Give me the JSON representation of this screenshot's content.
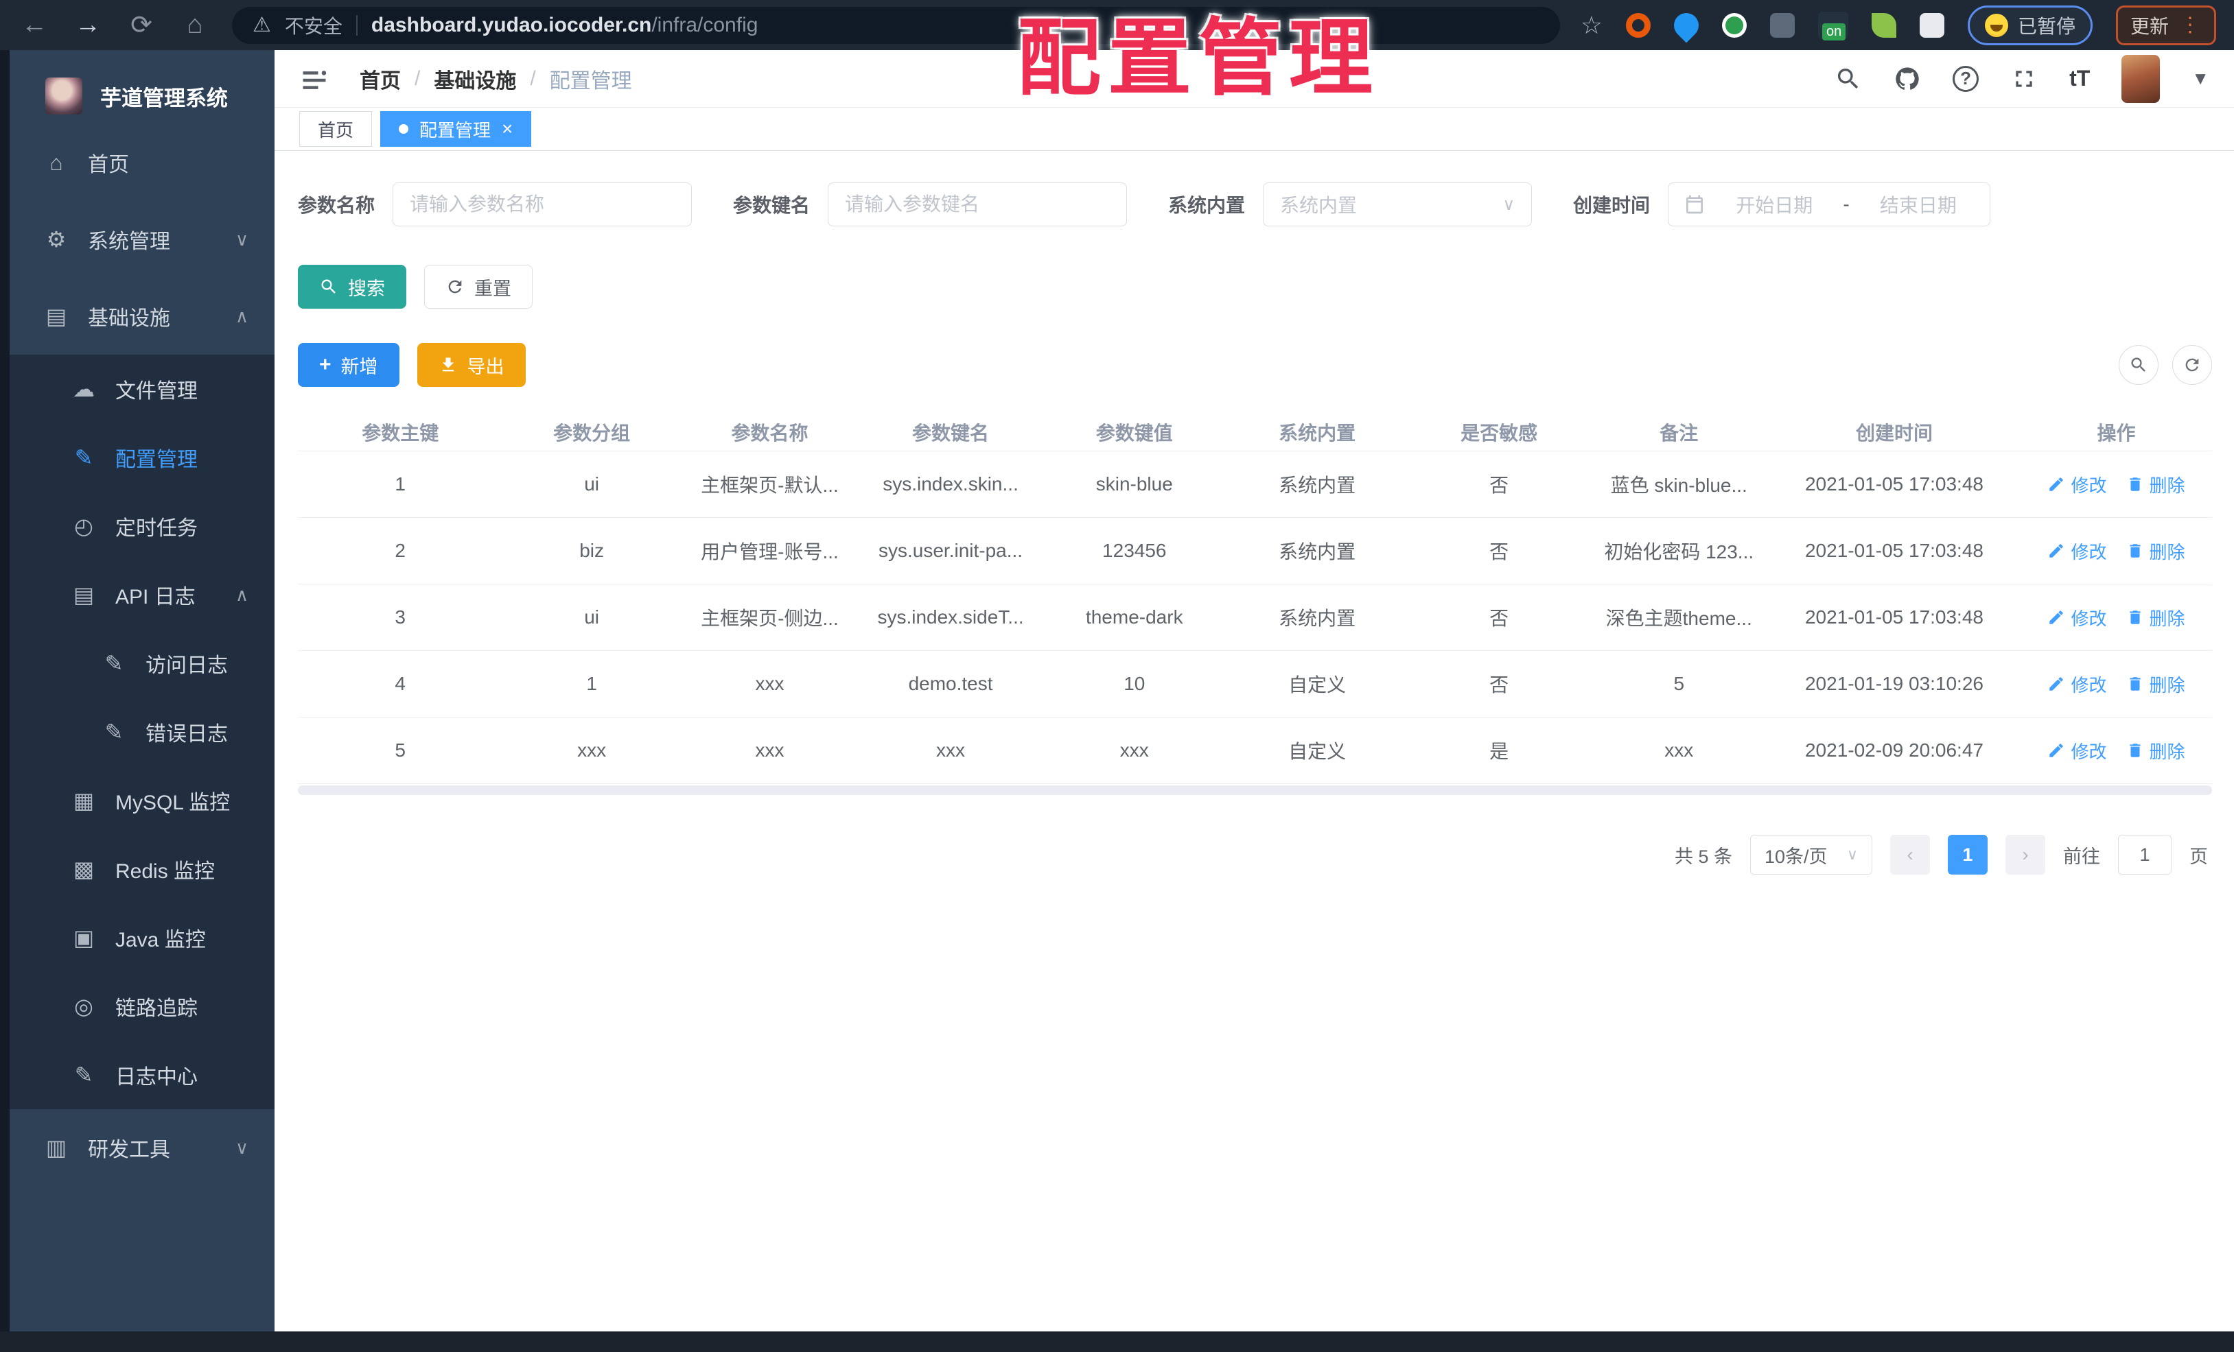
{
  "browser": {
    "insecure_label": "不安全",
    "url_host": "dashboard.yudao.iocoder.cn",
    "url_path": "/infra/config",
    "paused_label": "已暂停",
    "update_label": "更新"
  },
  "overlay": {
    "title": "配置管理",
    "color": "#ee2d52"
  },
  "sidebar": {
    "logo_title": "芋道管理系统",
    "items": [
      {
        "label": "首页",
        "level": 1,
        "icon": "home-icon",
        "glyph": "⌂"
      },
      {
        "label": "系统管理",
        "level": 1,
        "icon": "gear-icon",
        "glyph": "⚙",
        "chevron": "down"
      },
      {
        "label": "基础设施",
        "level": 1,
        "icon": "infra-icon",
        "glyph": "▤",
        "chevron": "up"
      },
      {
        "label": "文件管理",
        "level": 2,
        "icon": "cloud-icon",
        "glyph": "☁"
      },
      {
        "label": "配置管理",
        "level": 2,
        "icon": "edit-icon",
        "glyph": "✎",
        "active": true
      },
      {
        "label": "定时任务",
        "level": 2,
        "icon": "timer-icon",
        "glyph": "◴"
      },
      {
        "label": "API 日志",
        "level": 2,
        "icon": "api-log-icon",
        "glyph": "▤",
        "chevron": "up"
      },
      {
        "label": "访问日志",
        "level": 3,
        "icon": "access-log-icon",
        "glyph": "✎"
      },
      {
        "label": "错误日志",
        "level": 3,
        "icon": "error-log-icon",
        "glyph": "✎"
      },
      {
        "label": "MySQL 监控",
        "level": 2,
        "icon": "mysql-icon",
        "glyph": "▦"
      },
      {
        "label": "Redis 监控",
        "level": 2,
        "icon": "redis-icon",
        "glyph": "▩"
      },
      {
        "label": "Java 监控",
        "level": 2,
        "icon": "java-icon",
        "glyph": "▣"
      },
      {
        "label": "链路追踪",
        "level": 2,
        "icon": "trace-eye-icon",
        "glyph": "◎"
      },
      {
        "label": "日志中心",
        "level": 2,
        "icon": "log-center-icon",
        "glyph": "✎"
      },
      {
        "label": "研发工具",
        "level": 1,
        "icon": "toolbox-icon",
        "glyph": "▥",
        "chevron": "down"
      }
    ]
  },
  "header": {
    "breadcrumb": [
      "首页",
      "基础设施",
      "配置管理"
    ]
  },
  "tabs": [
    {
      "label": "首页",
      "active": false
    },
    {
      "label": "配置管理",
      "active": true
    }
  ],
  "filters": {
    "name_label": "参数名称",
    "name_placeholder": "请输入参数名称",
    "key_label": "参数键名",
    "key_placeholder": "请输入参数键名",
    "type_label": "系统内置",
    "type_placeholder": "系统内置",
    "date_label": "创建时间",
    "date_start": "开始日期",
    "date_sep": "-",
    "date_end": "结束日期"
  },
  "actions": {
    "search": "搜索",
    "reset": "重置",
    "add": "新增",
    "export": "导出"
  },
  "table": {
    "headers": [
      "参数主键",
      "参数分组",
      "参数名称",
      "参数键名",
      "参数键值",
      "系统内置",
      "是否敏感",
      "备注",
      "创建时间",
      "操作"
    ],
    "ops": {
      "edit": "修改",
      "delete": "删除"
    },
    "rows": [
      {
        "cells": [
          "1",
          "ui",
          "主框架页-默认...",
          "sys.index.skin...",
          "skin-blue",
          "系统内置",
          "否",
          "蓝色 skin-blue...",
          "2021-01-05 17:03:48"
        ]
      },
      {
        "cells": [
          "2",
          "biz",
          "用户管理-账号...",
          "sys.user.init-pa...",
          "123456",
          "系统内置",
          "否",
          "初始化密码 123...",
          "2021-01-05 17:03:48"
        ]
      },
      {
        "cells": [
          "3",
          "ui",
          "主框架页-侧边...",
          "sys.index.sideT...",
          "theme-dark",
          "系统内置",
          "否",
          "深色主题theme...",
          "2021-01-05 17:03:48"
        ]
      },
      {
        "cells": [
          "4",
          "1",
          "xxx",
          "demo.test",
          "10",
          "自定义",
          "否",
          "5",
          "2021-01-19 03:10:26"
        ]
      },
      {
        "cells": [
          "5",
          "xxx",
          "xxx",
          "xxx",
          "xxx",
          "自定义",
          "是",
          "xxx",
          "2021-02-09 20:06:47"
        ]
      }
    ]
  },
  "pagination": {
    "total": "共 5 条",
    "page_size": "10条/页",
    "current": "1",
    "goto_prefix": "前往",
    "goto_value": "1",
    "goto_suffix": "页"
  },
  "colors": {
    "primary": "#409eff",
    "search_button": "#2aa79b",
    "add_button": "#2d8cf0",
    "export_button": "#f1a40f",
    "sidebar_bg": "#2f4156",
    "submenu_bg": "#212e40"
  }
}
